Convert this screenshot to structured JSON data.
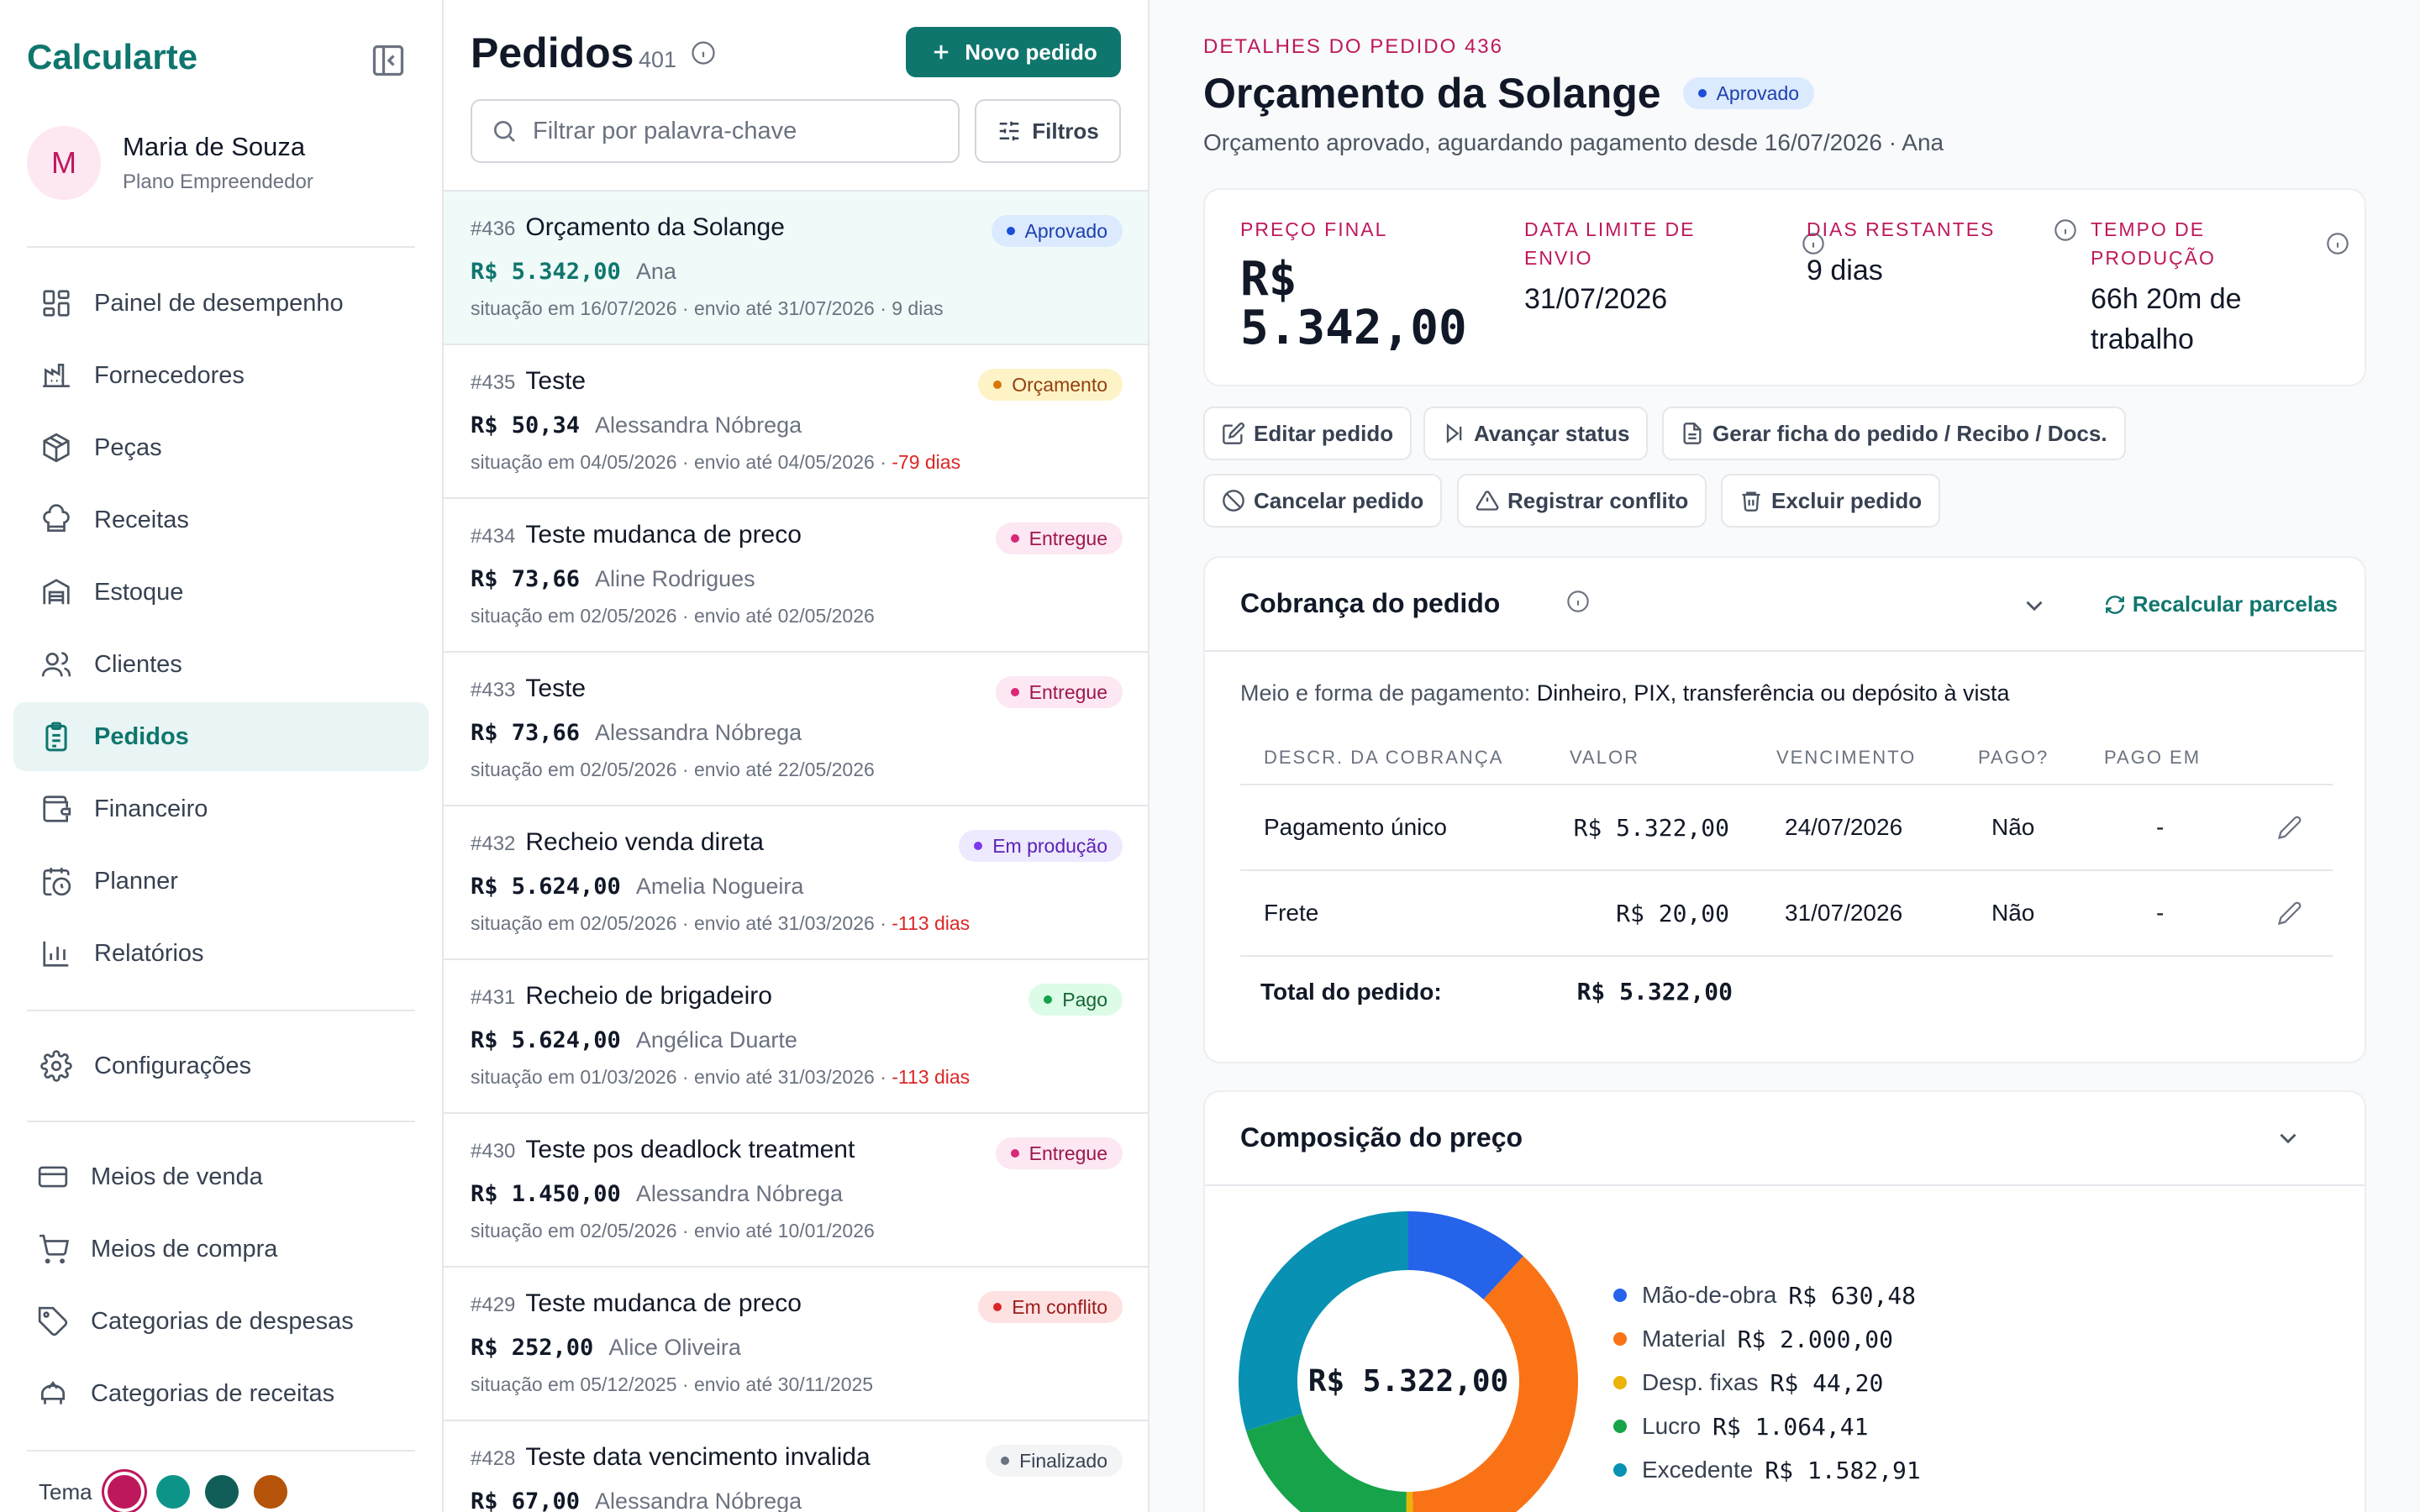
{
  "sidebar": {
    "brand": "Calcularte",
    "user": {
      "initial": "M",
      "name": "Maria de Souza",
      "plan": "Plano Empreendedor"
    },
    "main_items": [
      {
        "label": "Painel de desempenho",
        "icon": "dashboard-icon"
      },
      {
        "label": "Fornecedores",
        "icon": "factory-icon"
      },
      {
        "label": "Peças",
        "icon": "package-icon"
      },
      {
        "label": "Receitas",
        "icon": "chef-hat-icon"
      },
      {
        "label": "Estoque",
        "icon": "warehouse-icon"
      },
      {
        "label": "Clientes",
        "icon": "users-icon"
      },
      {
        "label": "Pedidos",
        "icon": "clipboard-list-icon",
        "active": true
      },
      {
        "label": "Financeiro",
        "icon": "wallet-icon"
      },
      {
        "label": "Planner",
        "icon": "calendar-clock-icon"
      },
      {
        "label": "Relatórios",
        "icon": "bar-chart-icon"
      }
    ],
    "settings_label": "Configurações",
    "config_items": [
      {
        "label": "Meios de venda",
        "icon": "credit-card-icon"
      },
      {
        "label": "Meios de compra",
        "icon": "shopping-cart-icon"
      },
      {
        "label": "Categorias de despesas",
        "icon": "tag-icon"
      },
      {
        "label": "Categorias de receitas",
        "icon": "piggy-bank-icon"
      }
    ],
    "theme_label": "Tema",
    "theme_colors": [
      "#be185d",
      "#0d9488",
      "#115e59",
      "#b45309"
    ]
  },
  "orders": {
    "title": "Pedidos",
    "count": "401",
    "new_button": "Novo pedido",
    "search_placeholder": "Filtrar por palavra-chave",
    "filters_button": "Filtros",
    "items": [
      {
        "num": "#436",
        "title": "Orçamento da Solange",
        "status": "Aprovado",
        "status_class": "b-aprovado",
        "price": "R$ 5.342,00",
        "client": "Ana",
        "meta": "situação em 16/07/2026 · envio até 31/07/2026 · 9 dias",
        "late": ""
      },
      {
        "num": "#435",
        "title": "Teste",
        "status": "Orçamento",
        "status_class": "b-orcamento",
        "price": "R$ 50,34",
        "client": "Alessandra Nóbrega",
        "meta": "situação em 04/05/2026 · envio até 04/05/2026 · ",
        "late": "-79 dias"
      },
      {
        "num": "#434",
        "title": "Teste mudanca de preco",
        "status": "Entregue",
        "status_class": "b-entregue",
        "price": "R$ 73,66",
        "client": "Aline Rodrigues",
        "meta": "situação em 02/05/2026 · envio até 02/05/2026",
        "late": ""
      },
      {
        "num": "#433",
        "title": "Teste",
        "status": "Entregue",
        "status_class": "b-entregue",
        "price": "R$ 73,66",
        "client": "Alessandra Nóbrega",
        "meta": "situação em 02/05/2026 · envio até 22/05/2026",
        "late": ""
      },
      {
        "num": "#432",
        "title": "Recheio venda direta",
        "status": "Em produção",
        "status_class": "b-producao",
        "price": "R$ 5.624,00",
        "client": "Amelia Nogueira",
        "meta": "situação em 02/05/2026 · envio até 31/03/2026 · ",
        "late": "-113 dias"
      },
      {
        "num": "#431",
        "title": "Recheio de brigadeiro",
        "status": "Pago",
        "status_class": "b-pago",
        "price": "R$ 5.624,00",
        "client": "Angélica Duarte",
        "meta": "situação em 01/03/2026 · envio até 31/03/2026 · ",
        "late": "-113 dias"
      },
      {
        "num": "#430",
        "title": "Teste pos deadlock treatment",
        "status": "Entregue",
        "status_class": "b-entregue",
        "price": "R$ 1.450,00",
        "client": "Alessandra Nóbrega",
        "meta": "situação em 02/05/2026 · envio até 10/01/2026",
        "late": ""
      },
      {
        "num": "#429",
        "title": "Teste mudanca de preco",
        "status": "Em conflito",
        "status_class": "b-conflito",
        "price": "R$ 252,00",
        "client": "Alice Oliveira",
        "meta": "situação em 05/12/2025 · envio até 30/11/2025",
        "late": ""
      },
      {
        "num": "#428",
        "title": "Teste data vencimento invalida",
        "status": "Finalizado",
        "status_class": "b-finalizado",
        "price": "R$ 67,00",
        "client": "Alessandra Nóbrega",
        "meta": "",
        "late": ""
      }
    ]
  },
  "details": {
    "kicker": "DETALHES DO PEDIDO 436",
    "title": "Orçamento da Solange",
    "status": "Aprovado",
    "subtitle": "Orçamento aprovado, aguardando pagamento desde 16/07/2026 · Ana",
    "metrics": {
      "final_price_label": "PREÇO FINAL",
      "final_price_line1": "R$",
      "final_price_line2": "5.342,00",
      "deadline_label_1": "DATA LIMITE DE",
      "deadline_label_2": "ENVIO",
      "deadline_value": "31/07/2026",
      "days_left_label": "DIAS RESTANTES",
      "days_left_value": "9 dias",
      "production_label_1": "TEMPO DE",
      "production_label_2": "PRODUÇÃO",
      "production_value_1": "66h 20m de",
      "production_value_2": "trabalho"
    },
    "actions": {
      "edit": "Editar pedido",
      "advance": "Avançar status",
      "docs": "Gerar ficha do pedido / Recibo / Docs.",
      "cancel": "Cancelar pedido",
      "conflict": "Registrar conflito",
      "delete": "Excluir pedido"
    },
    "billing": {
      "title": "Cobrança do pedido",
      "recalc": "Recalcular parcelas",
      "payment_label": "Meio e forma de pagamento:",
      "payment_value": "Dinheiro, PIX, transferência ou depósito à vista",
      "headers": {
        "desc": "DESCR. DA COBRANÇA",
        "value": "VALOR",
        "due": "VENCIMENTO",
        "paid": "PAGO?",
        "paid_at": "PAGO EM"
      },
      "rows": [
        {
          "desc": "Pagamento único",
          "value": "R$ 5.322,00",
          "due": "24/07/2026",
          "paid": "Não",
          "paid_at": "-"
        },
        {
          "desc": "Frete",
          "value": "R$ 20,00",
          "due": "31/07/2026",
          "paid": "Não",
          "paid_at": "-"
        }
      ],
      "total_label": "Total do pedido:",
      "total_value": "R$ 5.322,00"
    },
    "composition": {
      "title": "Composição do preço",
      "center": "R$ 5.322,00",
      "slices": [
        {
          "label": "Mão-de-obra",
          "value_text": "R$ 630,48",
          "value": 630.48,
          "color": "#2563eb"
        },
        {
          "label": "Material",
          "value_text": "R$ 2.000,00",
          "value": 2000.0,
          "color": "#f97316"
        },
        {
          "label": "Desp. fixas",
          "value_text": "R$ 44,20",
          "value": 44.2,
          "color": "#eab308"
        },
        {
          "label": "Lucro",
          "value_text": "R$ 1.064,41",
          "value": 1064.41,
          "color": "#16a34a"
        },
        {
          "label": "Excedente",
          "value_text": "R$ 1.582,91",
          "value": 1582.91,
          "color": "#0891b2"
        }
      ]
    }
  }
}
